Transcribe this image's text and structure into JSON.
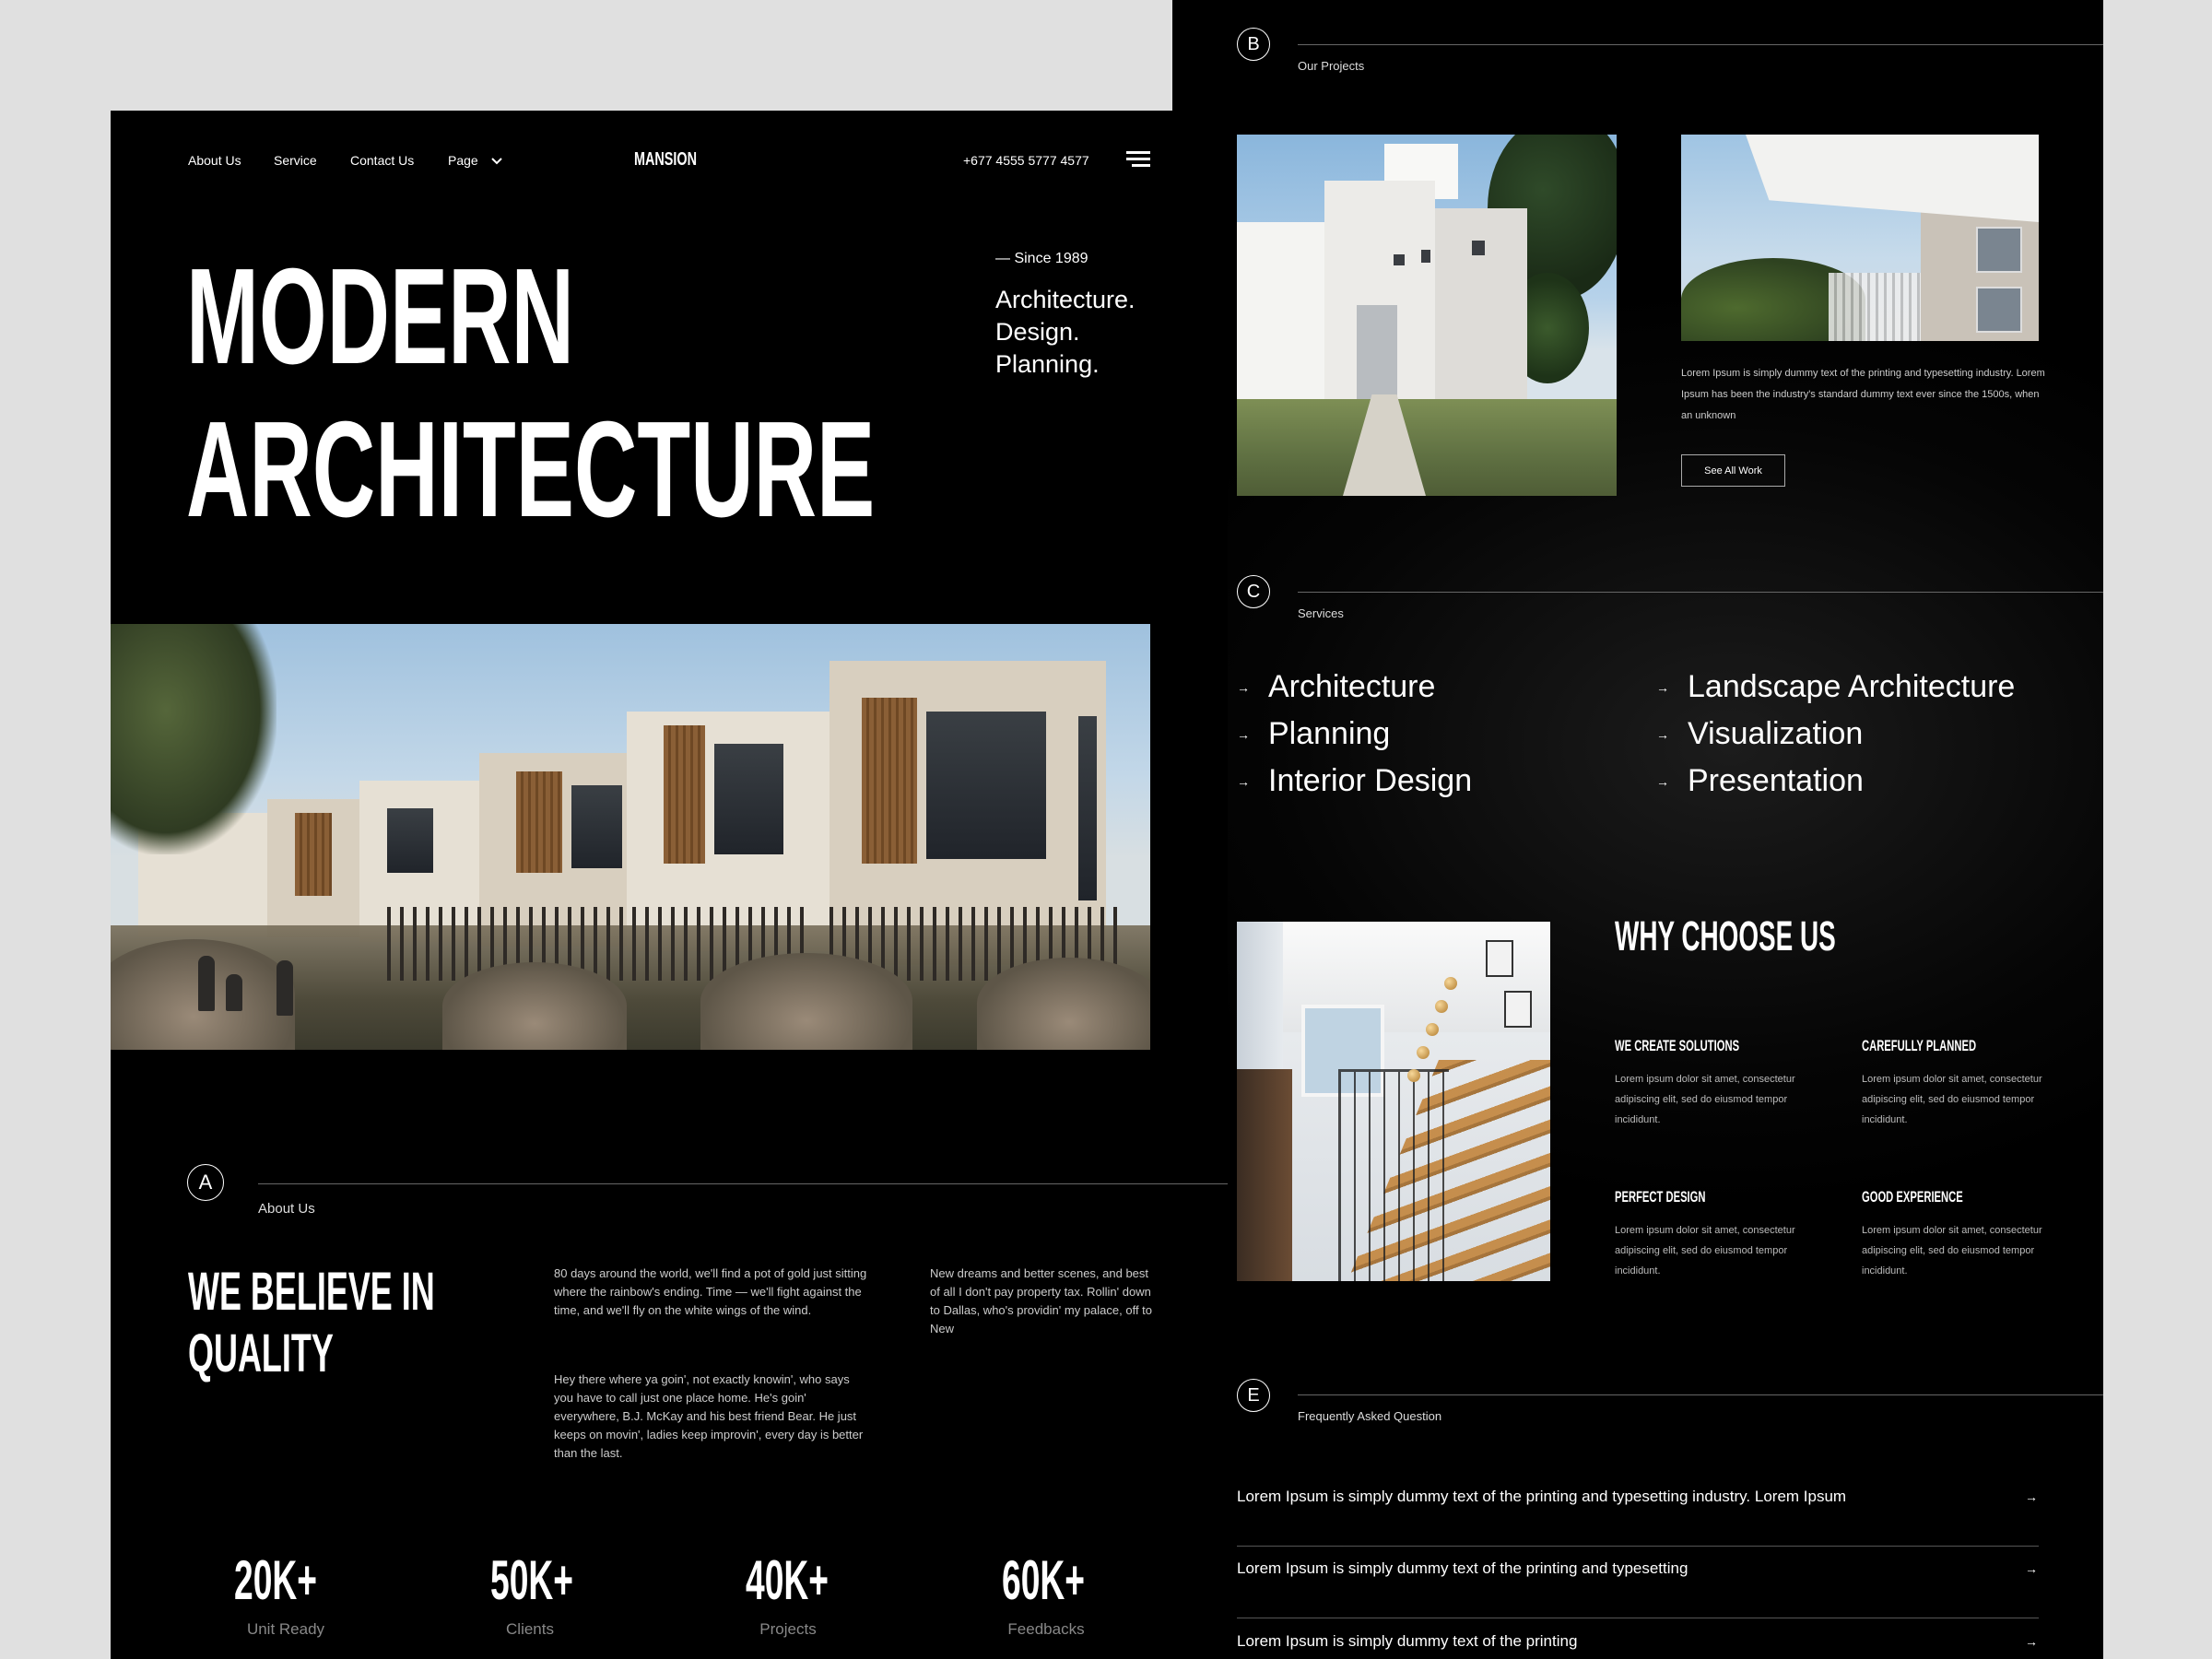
{
  "nav": {
    "links": [
      "About Us",
      "Service",
      "Contact Us",
      "Page"
    ],
    "brand": "MANSION",
    "phone": "+677 4555 5777 4577"
  },
  "hero": {
    "title_line1": "MODERN",
    "title_line2": "ARCHITECTURE",
    "since": "— Since 1989",
    "tagline": [
      "Architecture.",
      "Design.",
      "Planning."
    ]
  },
  "about": {
    "letter": "A",
    "label": "About Us",
    "title_line1": "WE BELIEVE IN",
    "title_line2": "QUALITY",
    "paragraph_1": "80 days around the world, we'll find a pot of gold just sitting where the rainbow's ending. Time — we'll fight against the time, and we'll fly on the white wings of the wind.",
    "paragraph_2": "Hey there where ya goin', not exactly knowin', who says you have to call just one place home. He's goin' everywhere, B.J. McKay and his best friend Bear. He just keeps on movin', ladies keep improvin', every day is better than the last.",
    "paragraph_3": "New dreams and better scenes, and best of all I don't pay property tax. Rollin' down to Dallas, who's providin' my palace, off to New"
  },
  "stats": [
    {
      "value": "20K+",
      "label": "Unit Ready"
    },
    {
      "value": "50K+",
      "label": "Clients"
    },
    {
      "value": "40K+",
      "label": "Projects"
    },
    {
      "value": "60K+",
      "label": "Feedbacks"
    }
  ],
  "projects": {
    "letter": "B",
    "label": "Our Projects",
    "description": "Lorem Ipsum is simply dummy text of the printing and typesetting industry. Lorem Ipsum has been the industry's standard dummy text ever since the 1500s, when an unknown",
    "button": "See All Work"
  },
  "services": {
    "letter": "C",
    "label": "Services",
    "items_left": [
      "Architecture",
      "Planning",
      "Interior Design"
    ],
    "items_right": [
      "Landscape Architecture",
      "Visualization",
      "Presentation"
    ]
  },
  "why": {
    "title": "WHY CHOOSE US",
    "items": [
      {
        "title": "WE CREATE SOLUTIONS",
        "text": "Lorem ipsum dolor sit amet, consectetur adipiscing elit, sed do eiusmod tempor incididunt."
      },
      {
        "title": "CAREFULLY PLANNED",
        "text": "Lorem ipsum dolor sit amet, consectetur adipiscing elit, sed do eiusmod tempor incididunt."
      },
      {
        "title": "PERFECT DESIGN",
        "text": "Lorem ipsum dolor sit amet, consectetur adipiscing elit, sed do eiusmod tempor incididunt."
      },
      {
        "title": "GOOD EXPERIENCE",
        "text": "Lorem ipsum dolor sit amet, consectetur adipiscing elit, sed do eiusmod tempor incididunt."
      }
    ]
  },
  "faq": {
    "letter": "E",
    "label": "Frequently Asked Question",
    "questions": [
      "Lorem Ipsum is simply dummy text of the printing and typesetting industry. Lorem Ipsum",
      "Lorem Ipsum is simply dummy text of the printing and typesetting",
      "Lorem Ipsum is simply dummy text of the printing"
    ]
  },
  "icons": {
    "arrow": "→",
    "dropdown": "chevron-down-icon",
    "menu": "hamburger-icon"
  }
}
